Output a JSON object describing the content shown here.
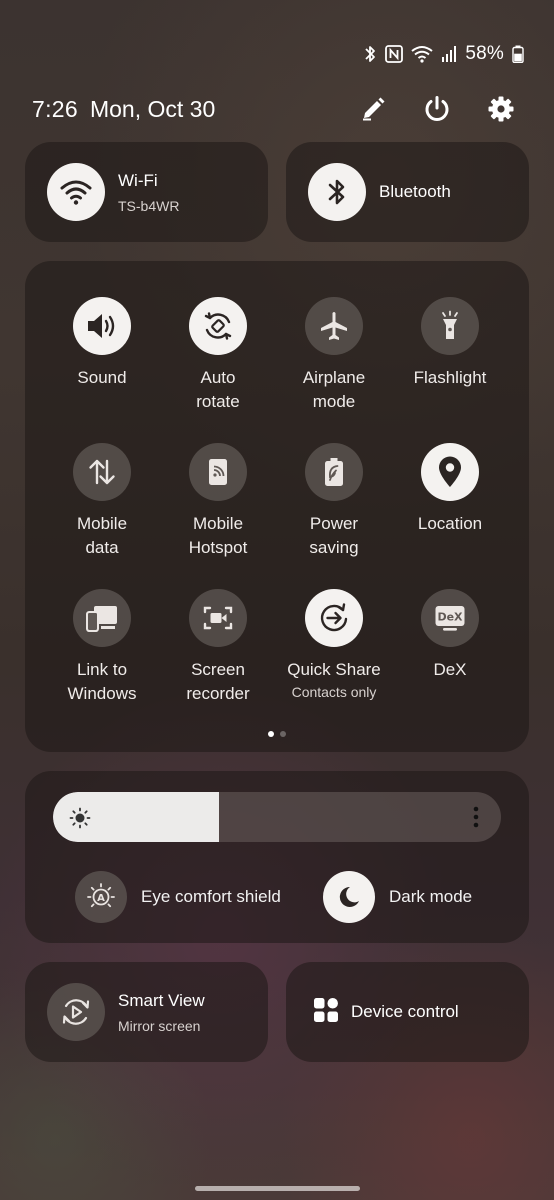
{
  "status": {
    "battery_pct": "58%"
  },
  "header": {
    "time": "7:26",
    "date": "Mon, Oct 30"
  },
  "wifi": {
    "title": "Wi-Fi",
    "sub": "TS-b4WR",
    "on": true
  },
  "bluetooth": {
    "title": "Bluetooth",
    "on": true
  },
  "tiles": [
    {
      "label": "Sound",
      "icon": "sound-icon",
      "on": true
    },
    {
      "label": "Auto\nrotate",
      "icon": "auto-rotate-icon",
      "on": true
    },
    {
      "label": "Airplane\nmode",
      "icon": "airplane-icon",
      "on": false
    },
    {
      "label": "Flashlight",
      "icon": "flashlight-icon",
      "on": false
    },
    {
      "label": "Mobile\ndata",
      "icon": "mobile-data-icon",
      "on": false
    },
    {
      "label": "Mobile\nHotspot",
      "icon": "hotspot-icon",
      "on": false
    },
    {
      "label": "Power\nsaving",
      "icon": "power-saving-icon",
      "on": false
    },
    {
      "label": "Location",
      "icon": "location-icon",
      "on": true
    },
    {
      "label": "Link to\nWindows",
      "icon": "link-to-windows-icon",
      "on": false
    },
    {
      "label": "Screen\nrecorder",
      "icon": "screen-recorder-icon",
      "on": false
    },
    {
      "label": "Quick Share",
      "sub": "Contacts only",
      "icon": "quick-share-icon",
      "on": true
    },
    {
      "label": "DeX",
      "icon": "dex-icon",
      "on": false
    }
  ],
  "dex_icon_text": "DeX",
  "pager": {
    "pages": 2,
    "active": 0
  },
  "brightness": {
    "level": 0.37
  },
  "eye_comfort": {
    "label": "Eye comfort shield",
    "on": false
  },
  "dark_mode": {
    "label": "Dark mode",
    "on": true
  },
  "smart_view": {
    "title": "Smart View",
    "sub": "Mirror screen"
  },
  "device_control": {
    "label": "Device control"
  }
}
